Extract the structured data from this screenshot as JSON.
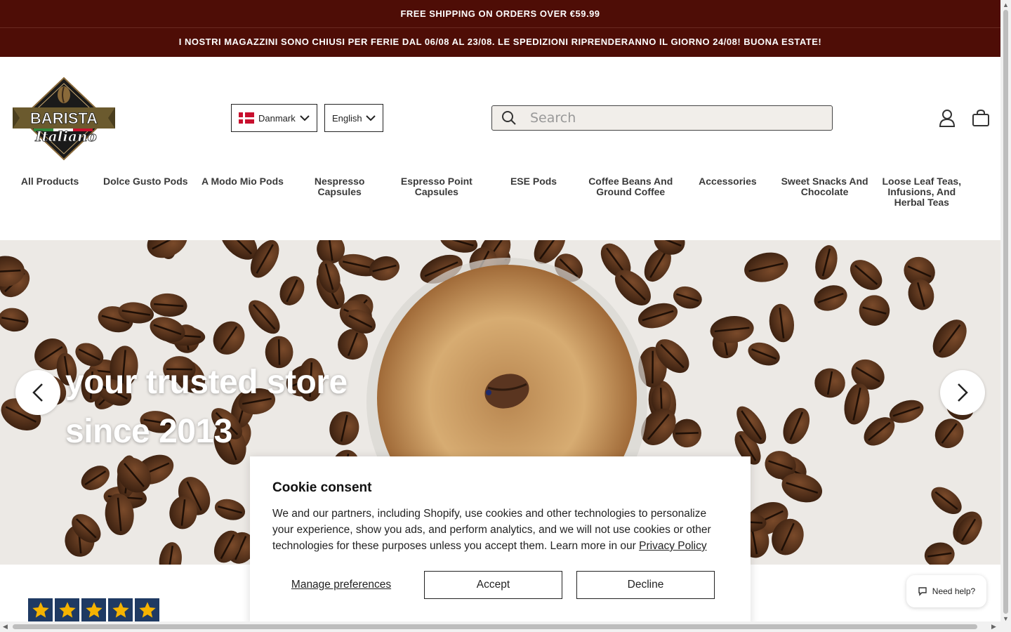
{
  "announcements": {
    "shipping": "FREE SHIPPING ON ORDERS OVER €59.99",
    "holiday": "I NOSTRI MAGAZZINI SONO CHIUSI PER FERIE DAL 06/08 AL 23/08. LE SPEDIZIONI RIPRENDERANNO IL GIORNO 24/08! BUONA ESTATE!"
  },
  "header": {
    "logo_text_top": "BARISTA",
    "logo_text_bottom": "Italiano",
    "country": "Danmark",
    "language": "English",
    "search_placeholder": "Search",
    "account_icon": "user-icon",
    "cart_icon": "bag-icon"
  },
  "nav": {
    "items": [
      "All Products",
      "Dolce Gusto Pods",
      "A Modo Mio Pods",
      "Nespresso Capsules",
      "Espresso Point Capsules",
      "ESE Pods",
      "Coffee Beans And Ground Coffee",
      "Accessories",
      "Sweet Snacks And Chocolate",
      "Loose Leaf Teas, Infusions, And Herbal Teas"
    ]
  },
  "hero": {
    "line1": "your trusted store",
    "line2": "since 2013"
  },
  "rating": {
    "stars": 5
  },
  "cookie": {
    "title": "Cookie consent",
    "body": "We and our partners, including Shopify, use cookies and other technologies to personalize your experience, show you ads, and perform analytics, and we will not use cookies or other technologies for these purposes unless you accept them. Learn more in our ",
    "policy_link": "Privacy Policy",
    "manage": "Manage preferences",
    "accept": "Accept",
    "decline": "Decline"
  },
  "help": {
    "label": "Need help?"
  },
  "colors": {
    "brand_dark": "#4e0d06",
    "star_bg": "#1f3a63",
    "star": "#f5b301"
  }
}
